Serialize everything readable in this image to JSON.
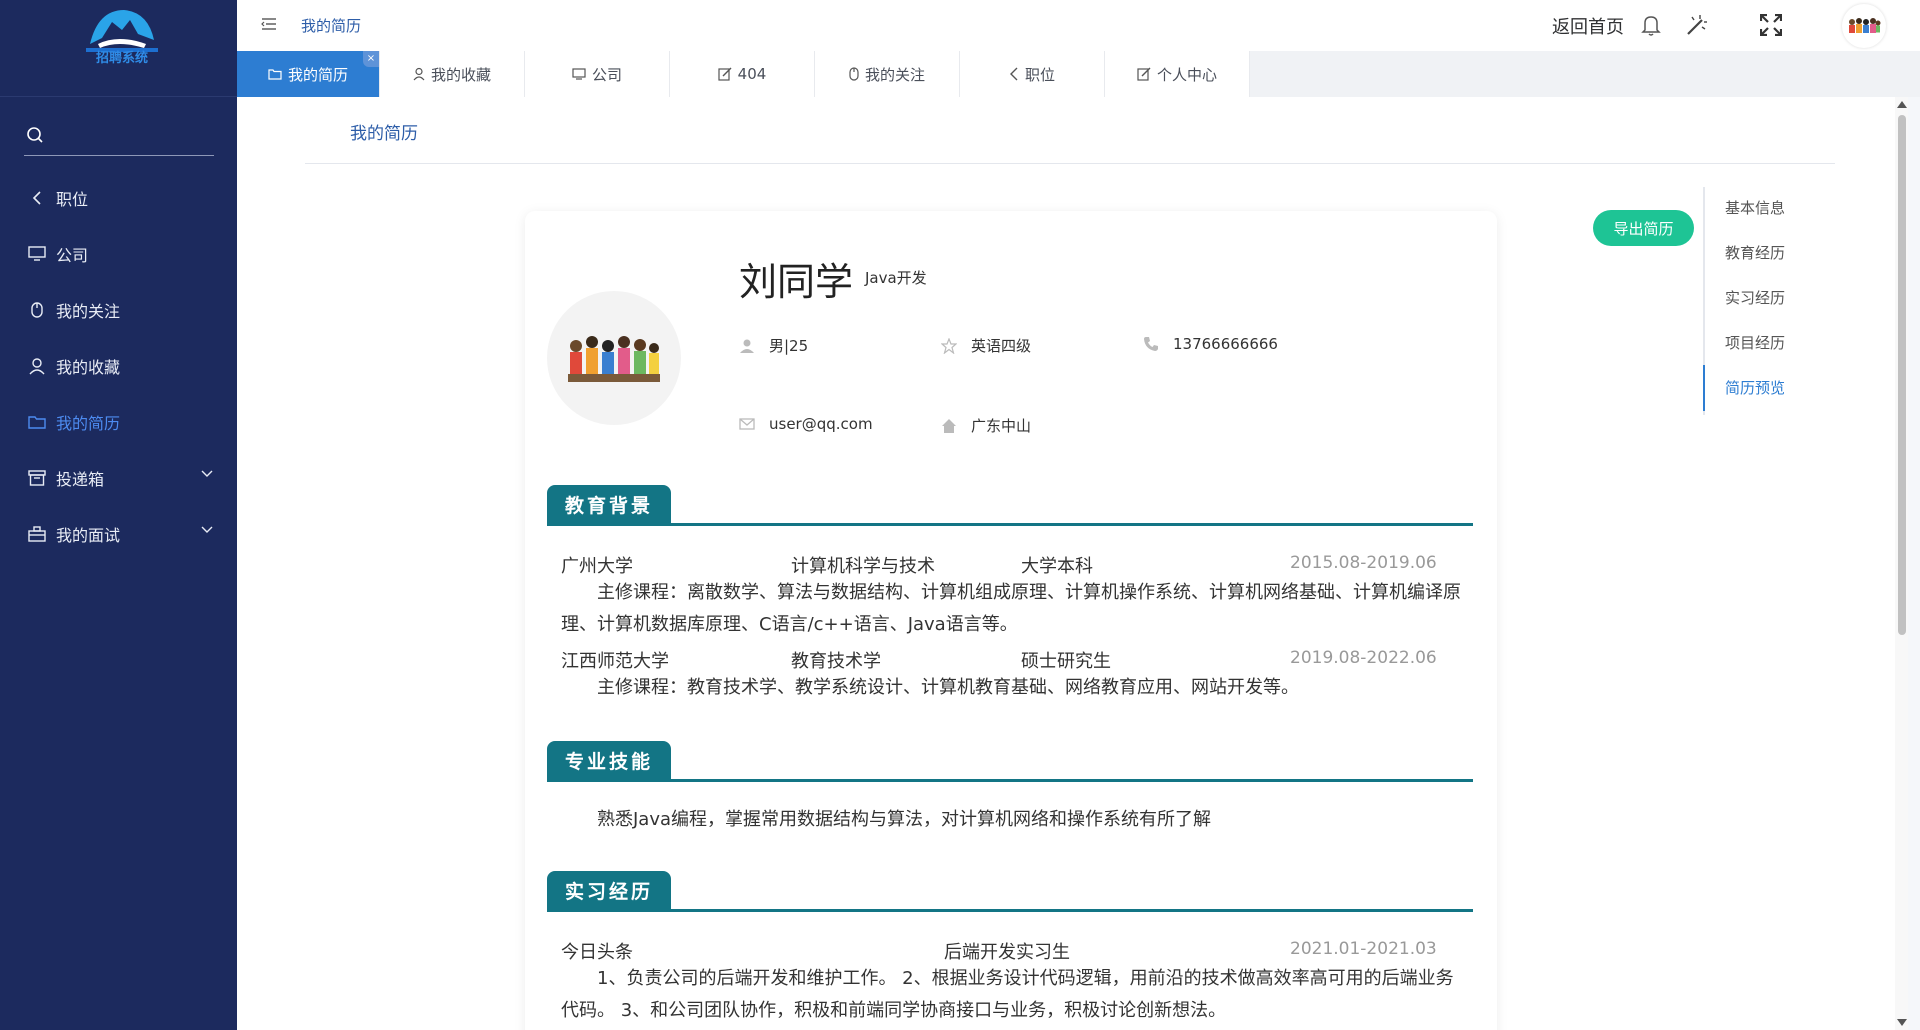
{
  "sidebar": {
    "logo_text": "招聘系统",
    "menu": [
      {
        "label": "职位"
      },
      {
        "label": "公司"
      },
      {
        "label": "我的关注"
      },
      {
        "label": "我的收藏"
      },
      {
        "label": "我的简历"
      },
      {
        "label": "投递箱"
      },
      {
        "label": "我的面试"
      }
    ]
  },
  "topbar": {
    "breadcrumb": "我的简历",
    "home_link": "返回首页"
  },
  "tabs": [
    {
      "label": "我的简历",
      "close": "×"
    },
    {
      "label": "我的收藏"
    },
    {
      "label": "公司"
    },
    {
      "label": "404"
    },
    {
      "label": "我的关注"
    },
    {
      "label": "职位"
    },
    {
      "label": "个人中心"
    }
  ],
  "page": {
    "title": "我的简历",
    "export_label": "导出简历"
  },
  "resume": {
    "name": "刘同学",
    "role": "Java开发",
    "gender_age": "男|25",
    "english": "英语四级",
    "phone": "13766666666",
    "email": "user@qq.com",
    "location": "广东中山",
    "education_title": "教育背景",
    "education": [
      {
        "school": "广州大学",
        "major": "计算机科学与技术",
        "degree": "大学本科",
        "date": "2015.08-2019.06",
        "courses": "主修课程：离散数学、算法与数据结构、计算机组成原理、计算机操作系统、计算机网络基础、计算机编译原理、计算机数据库原理、C语言/c++语言、Java语言等。"
      },
      {
        "school": "江西师范大学",
        "major": "教育技术学",
        "degree": "硕士研究生",
        "date": "2019.08-2022.06",
        "courses": "主修课程：教育技术学、教学系统设计、计算机教育基础、网络教育应用、网站开发等。"
      }
    ],
    "skills_title": "专业技能",
    "skills": "熟悉Java编程，掌握常用数据结构与算法，对计算机网络和操作系统有所了解",
    "internship_title": "实习经历",
    "internship": {
      "company": "今日头条",
      "position": "后端开发实习生",
      "date": "2021.01-2021.03",
      "desc": "1、负责公司的后端开发和维护工作。 2、根据业务设计代码逻辑，用前沿的技术做高效率高可用的后端业务代码。 3、和公司团队协作，积极和前端同学协商接口与业务，积极讨论创新想法。"
    }
  },
  "anchor_nav": [
    {
      "label": "基本信息"
    },
    {
      "label": "教育经历"
    },
    {
      "label": "实习经历"
    },
    {
      "label": "项目经历"
    },
    {
      "label": "简历预览"
    }
  ],
  "colors": {
    "sidebar_bg": "#1c2a5e",
    "accent_blue": "#2d7dd2",
    "section_teal": "#137585",
    "export_green": "#1ec495"
  }
}
